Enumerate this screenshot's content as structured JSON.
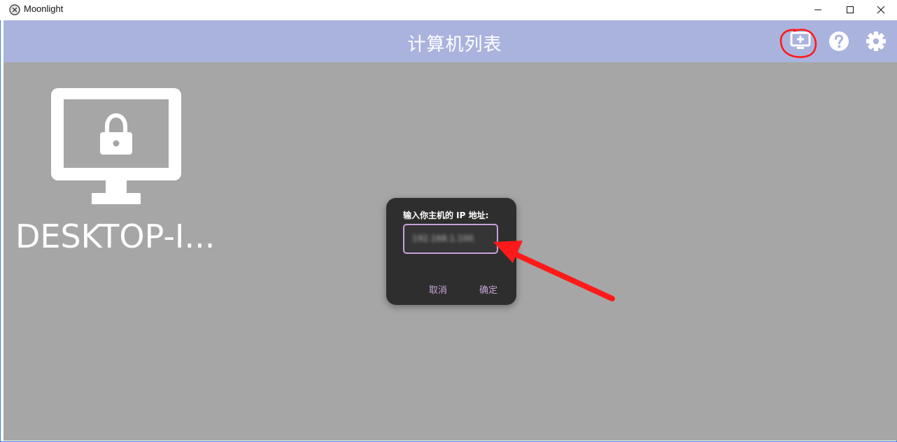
{
  "window": {
    "title": "Moonlight",
    "icon": "moonlight-icon"
  },
  "window_controls": {
    "minimize": "minimize-icon",
    "maximize": "maximize-icon",
    "close": "close-icon"
  },
  "appbar": {
    "title": "计算机列表",
    "color": "#aab3de",
    "actions": [
      "add-pc-icon",
      "help-icon",
      "settings-icon"
    ]
  },
  "computers": [
    {
      "name": "DESKTOP-I...",
      "icon": "locked-monitor-icon"
    }
  ],
  "dialog": {
    "label": "输入你主机的 IP 地址:",
    "ip_value": "192.168.1.100",
    "cancel_label": "取消",
    "ok_label": "确定",
    "accent": "#c5a3d6"
  },
  "annotations": {
    "color": "#ff1a1a"
  }
}
